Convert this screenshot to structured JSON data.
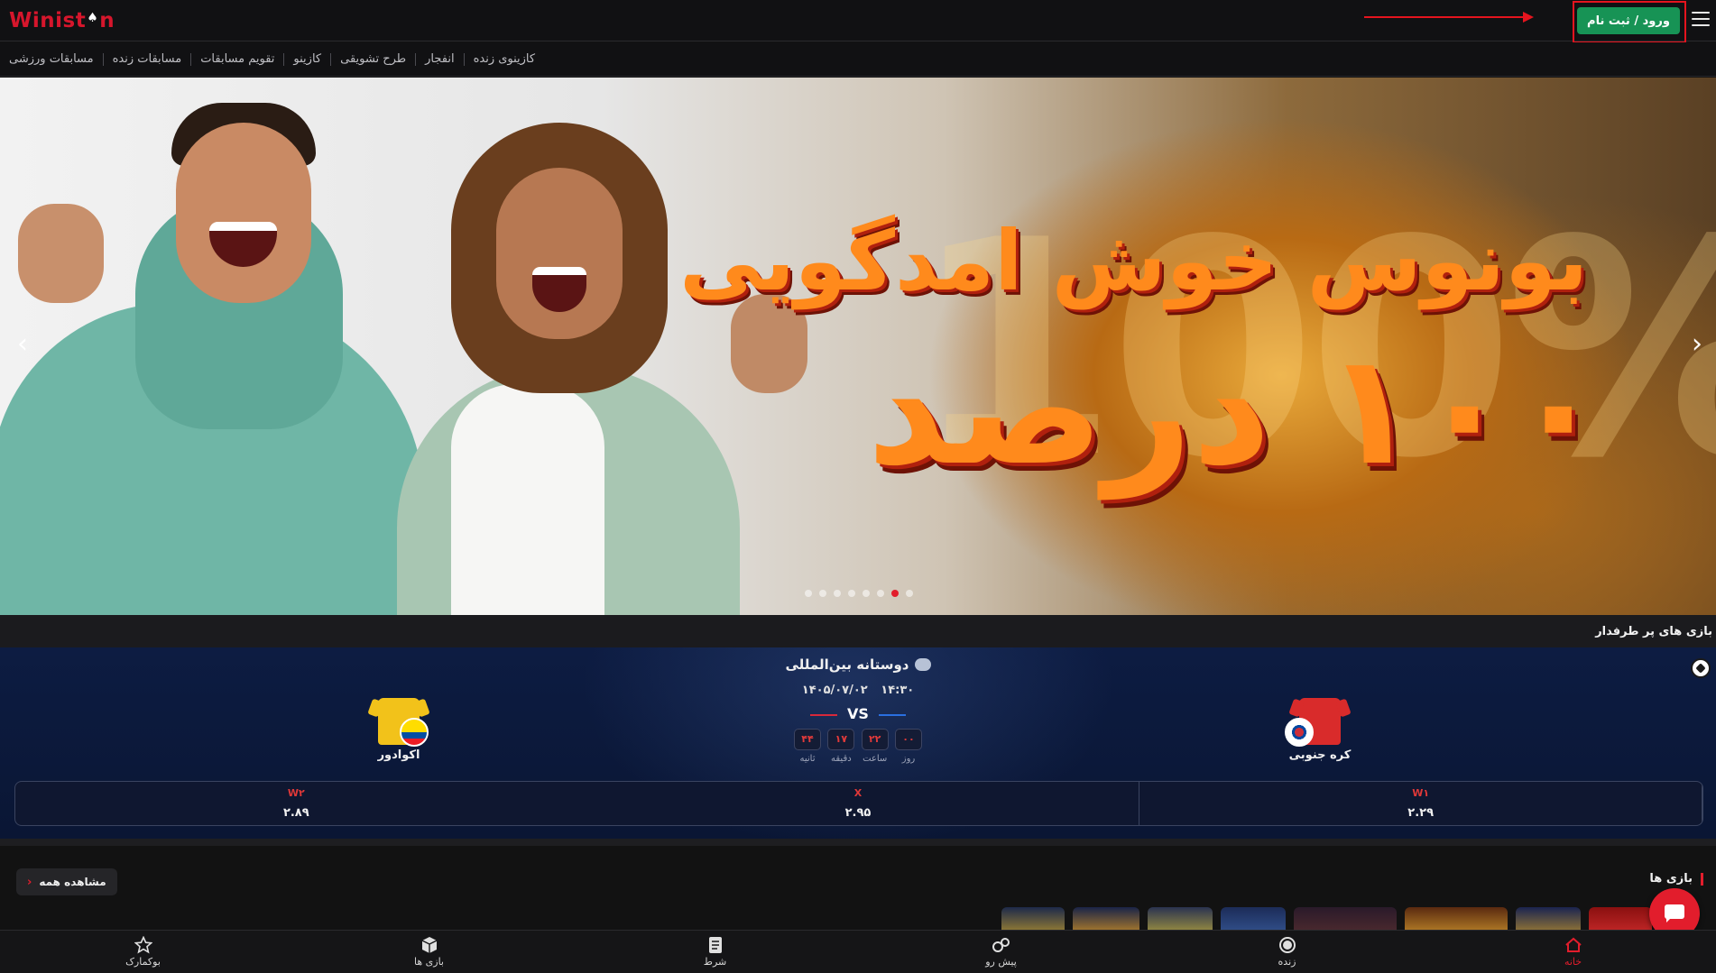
{
  "header": {
    "logo_pre": "Winist",
    "logo_post": "n",
    "login_label": "ورود / ثبت نام"
  },
  "nav": [
    "مسابقات ورزشی",
    "مسابقات زنده",
    "تقویم مسابقات",
    "کازینو",
    "طرح تشویقی",
    "انفجار",
    "کازینوی زنده"
  ],
  "banner": {
    "line1": "بونوس خوش امدگویی",
    "line2": "۱۰۰ درصد",
    "ghost": "100%",
    "slides_total": 8,
    "active_slide": 7
  },
  "popular": {
    "title": "بازی های پر طرفدار",
    "league": "دوستانه بین‌المللی",
    "date": "۱۴۰۵/۰۷/۰۲",
    "time": "۱۴:۳۰",
    "vs": "VS",
    "countdown": [
      {
        "value": "۴۴",
        "label": "ثانیه"
      },
      {
        "value": "۱۷",
        "label": "دقیقه"
      },
      {
        "value": "۲۲",
        "label": "ساعت"
      },
      {
        "value": "۰۰",
        "label": "روز"
      }
    ],
    "home_team": "کره جنوبی",
    "away_team": "اکوادور",
    "odds": [
      {
        "label": "W۱",
        "value": "۲.۲۹"
      },
      {
        "label": "X",
        "value": "۲.۹۵"
      },
      {
        "label": "W۲",
        "value": "۲.۸۹"
      }
    ]
  },
  "games": {
    "title": "بازی ها",
    "see_all": "مشاهده همه"
  },
  "bottom_nav": [
    {
      "label": "خانه",
      "icon": "home-icon",
      "active": true
    },
    {
      "label": "زنده",
      "icon": "live-icon",
      "active": false
    },
    {
      "label": "پیش رو",
      "icon": "upcoming-icon",
      "active": false
    },
    {
      "label": "شرط",
      "icon": "betslip-icon",
      "active": false
    },
    {
      "label": "بازی ها",
      "icon": "games-icon",
      "active": false
    },
    {
      "label": "بوکمارک",
      "icon": "star-icon",
      "active": false
    }
  ],
  "colors": {
    "brand_red": "#e21d2c",
    "login_green": "#179355",
    "match_navy": "#0d1c42"
  }
}
